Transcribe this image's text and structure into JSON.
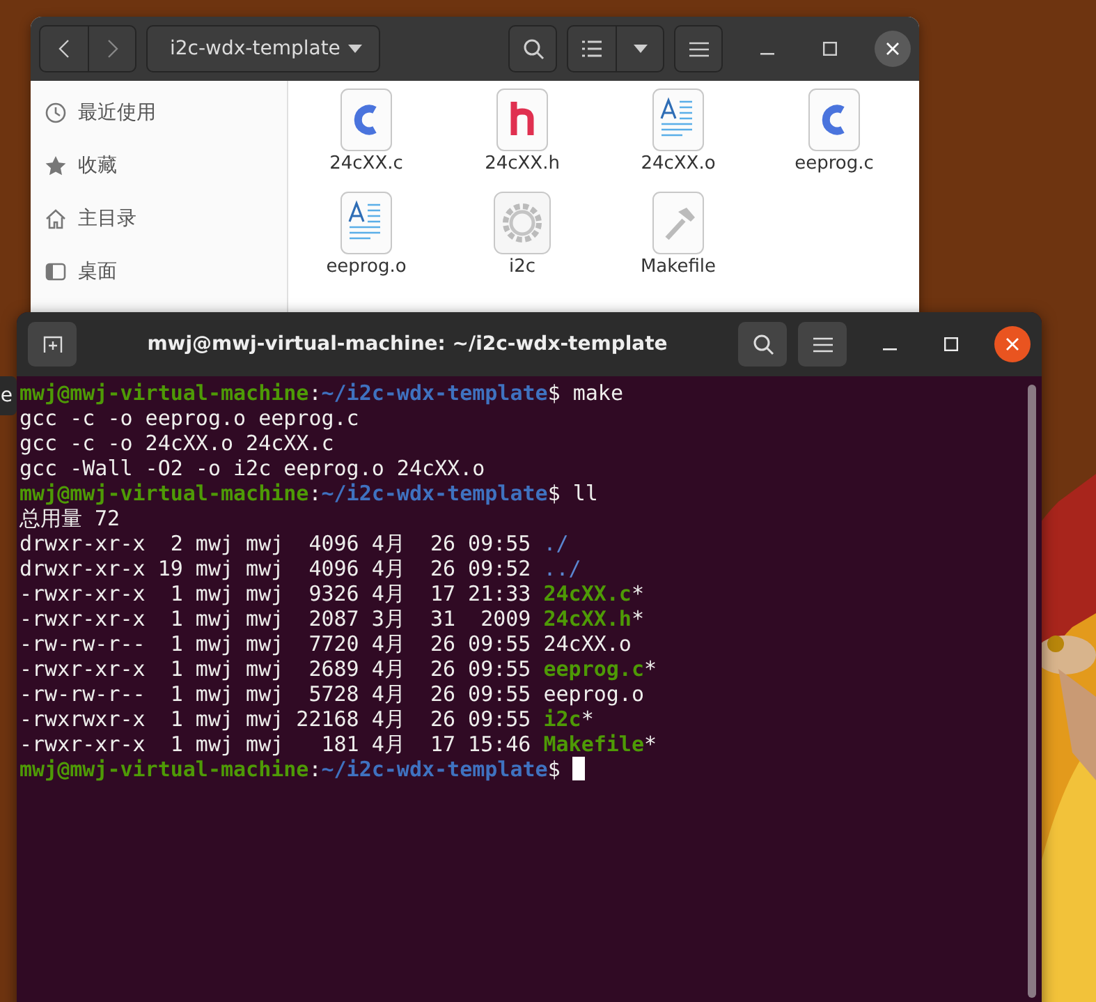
{
  "files_window": {
    "location": "i2c-wdx-template",
    "sidebar": [
      {
        "label": "最近使用",
        "kind": "recent"
      },
      {
        "label": "收藏",
        "kind": "starred"
      },
      {
        "label": "主目录",
        "kind": "home"
      },
      {
        "label": "桌面",
        "kind": "desktop"
      }
    ],
    "files": [
      {
        "name": "24cXX.c",
        "kind": "c"
      },
      {
        "name": "24cXX.h",
        "kind": "h"
      },
      {
        "name": "24cXX.o",
        "kind": "object"
      },
      {
        "name": "eeprog.c",
        "kind": "c"
      },
      {
        "name": "eeprog.o",
        "kind": "object"
      },
      {
        "name": "i2c",
        "kind": "executable"
      },
      {
        "name": "Makefile",
        "kind": "makefile"
      }
    ]
  },
  "tooltip": "e",
  "terminal": {
    "title": "mwj@mwj-virtual-machine: ~/i2c-wdx-template",
    "lines": [
      {
        "kind": "prompt",
        "user": "mwj@mwj-virtual-machine",
        "separator": ":",
        "path": "~/i2c-wdx-template",
        "symbol": "$",
        "command": "make"
      },
      {
        "kind": "output",
        "text": "gcc -c -o eeprog.o eeprog.c"
      },
      {
        "kind": "output",
        "text": "gcc -c -o 24cXX.o 24cXX.c"
      },
      {
        "kind": "output",
        "text": "gcc -Wall -O2 -o i2c eeprog.o 24cXX.o"
      },
      {
        "kind": "prompt",
        "user": "mwj@mwj-virtual-machine",
        "separator": ":",
        "path": "~/i2c-wdx-template",
        "symbol": "$",
        "command": "ll"
      },
      {
        "kind": "output",
        "text": "总用量 72"
      },
      {
        "kind": "listing",
        "info": "drwxr-xr-x  2 mwj mwj  4096 4月  26 09:55",
        "name": "./",
        "color": "#5a86d0",
        "bold": false
      },
      {
        "kind": "listing",
        "info": "drwxr-xr-x 19 mwj mwj  4096 4月  26 09:52",
        "name": "../",
        "color": "#5a86d0",
        "bold": false
      },
      {
        "kind": "listing",
        "info": "-rwxr-xr-x  1 mwj mwj  9326 4月  17 21:33",
        "name": "24cXX.c",
        "suffix": "*",
        "color": "#4e9a06",
        "bold": true
      },
      {
        "kind": "listing",
        "info": "-rwxr-xr-x  1 mwj mwj  2087 3月  31  2009",
        "name": "24cXX.h",
        "suffix": "*",
        "color": "#4e9a06",
        "bold": true
      },
      {
        "kind": "listing",
        "info": "-rw-rw-r--  1 mwj mwj  7720 4月  26 09:55",
        "name": "24cXX.o",
        "color": "#eeeeec",
        "bold": false
      },
      {
        "kind": "listing",
        "info": "-rwxr-xr-x  1 mwj mwj  2689 4月  26 09:55",
        "name": "eeprog.c",
        "suffix": "*",
        "color": "#4e9a06",
        "bold": true
      },
      {
        "kind": "listing",
        "info": "-rw-rw-r--  1 mwj mwj  5728 4月  26 09:55",
        "name": "eeprog.o",
        "color": "#eeeeec",
        "bold": false
      },
      {
        "kind": "listing",
        "info": "-rwxrwxr-x  1 mwj mwj 22168 4月  26 09:55",
        "name": "i2c",
        "suffix": "*",
        "color": "#4e9a06",
        "bold": true
      },
      {
        "kind": "listing",
        "info": "-rwxr-xr-x  1 mwj mwj   181 4月  17 15:46",
        "name": "Makefile",
        "suffix": "*",
        "color": "#4e9a06",
        "bold": true
      },
      {
        "kind": "prompt",
        "user": "mwj@mwj-virtual-machine",
        "separator": ":",
        "path": "~/i2c-wdx-template",
        "symbol": "$",
        "cursor": true
      }
    ]
  }
}
